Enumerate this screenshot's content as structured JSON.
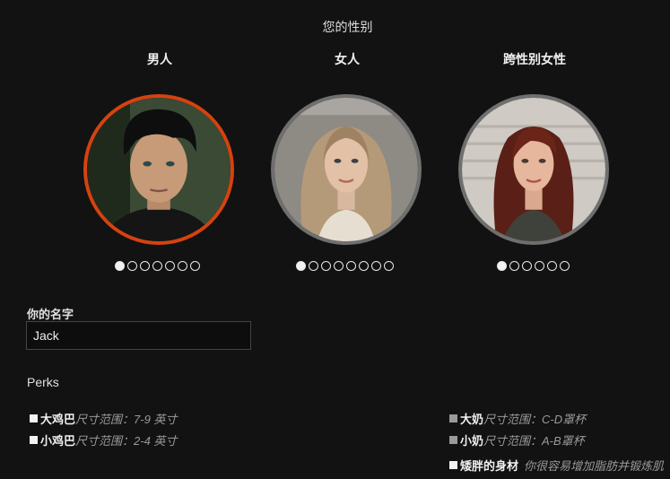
{
  "gender": {
    "title": "您的性别",
    "options": [
      {
        "label": "男人",
        "dots": 7,
        "active_dot": 0,
        "selected": true
      },
      {
        "label": "女人",
        "dots": 8,
        "active_dot": 0,
        "selected": false
      },
      {
        "label": "跨性别女性",
        "dots": 6,
        "active_dot": 0,
        "selected": false
      }
    ]
  },
  "name": {
    "label": "你的名字",
    "value": "Jack"
  },
  "perks": {
    "title": "Perks",
    "items": [
      {
        "name": "大鸡巴",
        "desc": "尺寸范围：7-9 英寸"
      },
      {
        "name": "小鸡巴",
        "desc": "尺寸范围：2-4 英寸"
      },
      {
        "name": "大奶",
        "desc": "尺寸范围：C-D罩杯"
      },
      {
        "name": "小奶",
        "desc": "尺寸范围：A-B罩杯"
      },
      {
        "name": "矮胖的身材",
        "desc": "你很容易增加脂肪并锻炼肌"
      }
    ]
  },
  "colors": {
    "selected_border": "#d6420f",
    "unselected_border": "#6f6f6f",
    "background": "#121212"
  }
}
